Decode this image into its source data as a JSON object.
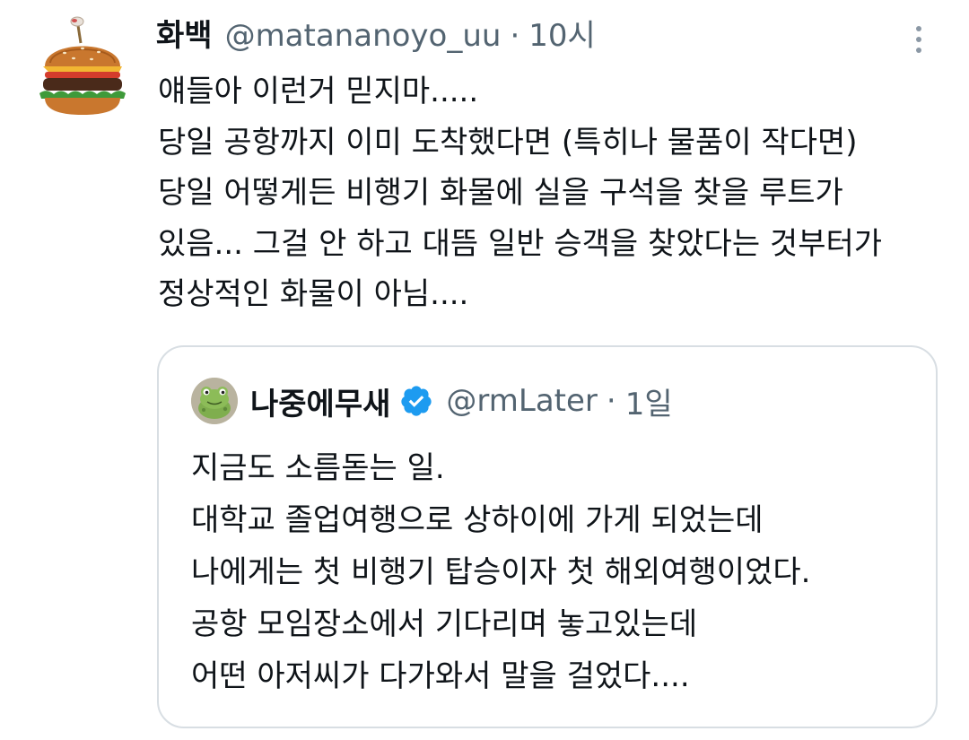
{
  "tweet": {
    "author": {
      "display_name": "화백",
      "handle": "@matananoyo_uu",
      "avatar_icon": "hamburger-avatar-icon"
    },
    "separator": "·",
    "time": "10시",
    "lines": [
      "얘들아 이런거 믿지마.....",
      "당일 공항까지 이미 도착했다면 (특히나 물품이 작다면)",
      "당일 어떻게든 비행기 화물에 실을 구석을 찾을 루트가",
      "있음... 그걸 안 하고 대뜸 일반 승객을 찾았다는 것부터가",
      "정상적인 화물이 아님...."
    ],
    "more_icon": "more-vertical-icon"
  },
  "quoted": {
    "author": {
      "display_name": "나중에무새",
      "handle": "@rmLater",
      "verified": true,
      "avatar_icon": "frog-avatar-icon",
      "verified_icon": "verified-badge-icon"
    },
    "separator": "·",
    "time": "1일",
    "lines": [
      "지금도 소름돋는 일.",
      "대학교 졸업여행으로 상하이에 가게 되었는데",
      "나에게는 첫 비행기 탑승이자 첫 해외여행이었다.",
      "공항 모임장소에서 기다리며 놓고있는데",
      "어떤 아저씨가 다가와서 말을 걸었다...."
    ]
  },
  "colors": {
    "text": "#0f1419",
    "secondary": "#536471",
    "border": "#d8dee3",
    "verified": "#1d9bf0"
  }
}
